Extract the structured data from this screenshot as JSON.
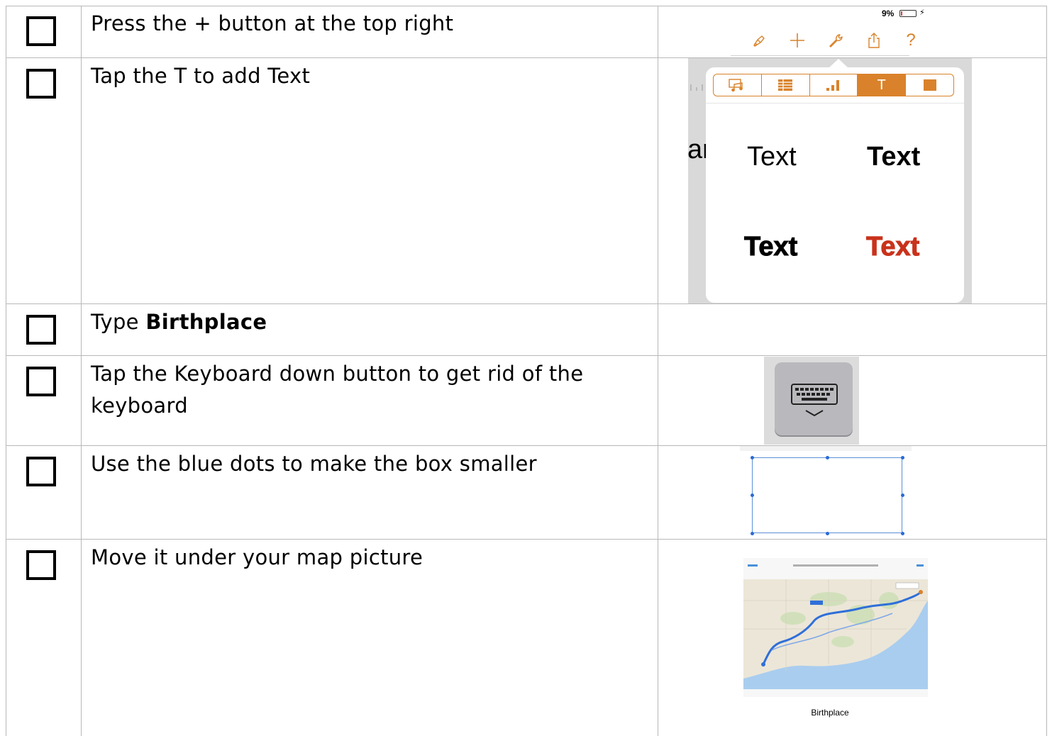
{
  "steps": [
    {
      "text": "Press the + button at the top right"
    },
    {
      "text": "Tap the T to add Text"
    },
    {
      "prefix": "Type ",
      "bold": "Birthplace"
    },
    {
      "line1": "Tap the Keyboard down button to get rid of the",
      "line2": "keyboard"
    },
    {
      "text": "Use the blue dots to make the box smaller"
    },
    {
      "text": "Move it under your map picture"
    }
  ],
  "toolbar": {
    "battery_percent": "9%",
    "battery_level": 0.09,
    "accent": "#d9822b",
    "icons": [
      "paintbrush-icon",
      "plus-icon",
      "wrench-icon",
      "share-icon",
      "help-icon"
    ],
    "help_label": "?"
  },
  "text_popover": {
    "tabs": [
      "media-icon",
      "table-icon",
      "chart-icon",
      "text-icon",
      "shape-icon"
    ],
    "active_tab": "T",
    "cut_text": "ar",
    "styles": [
      {
        "label": "Text",
        "weight": "normal",
        "color": "#000000"
      },
      {
        "label": "Text",
        "weight": "bold",
        "color": "#000000"
      },
      {
        "label": "Text",
        "weight": "black",
        "color": "#000000"
      },
      {
        "label": "Text",
        "weight": "black",
        "color": "#c9321b"
      }
    ]
  },
  "keyboard_button": {
    "icon": "keyboard-dismiss-icon"
  },
  "map_picture": {
    "caption": "Birthplace",
    "route_color": "#2f6fd9"
  }
}
